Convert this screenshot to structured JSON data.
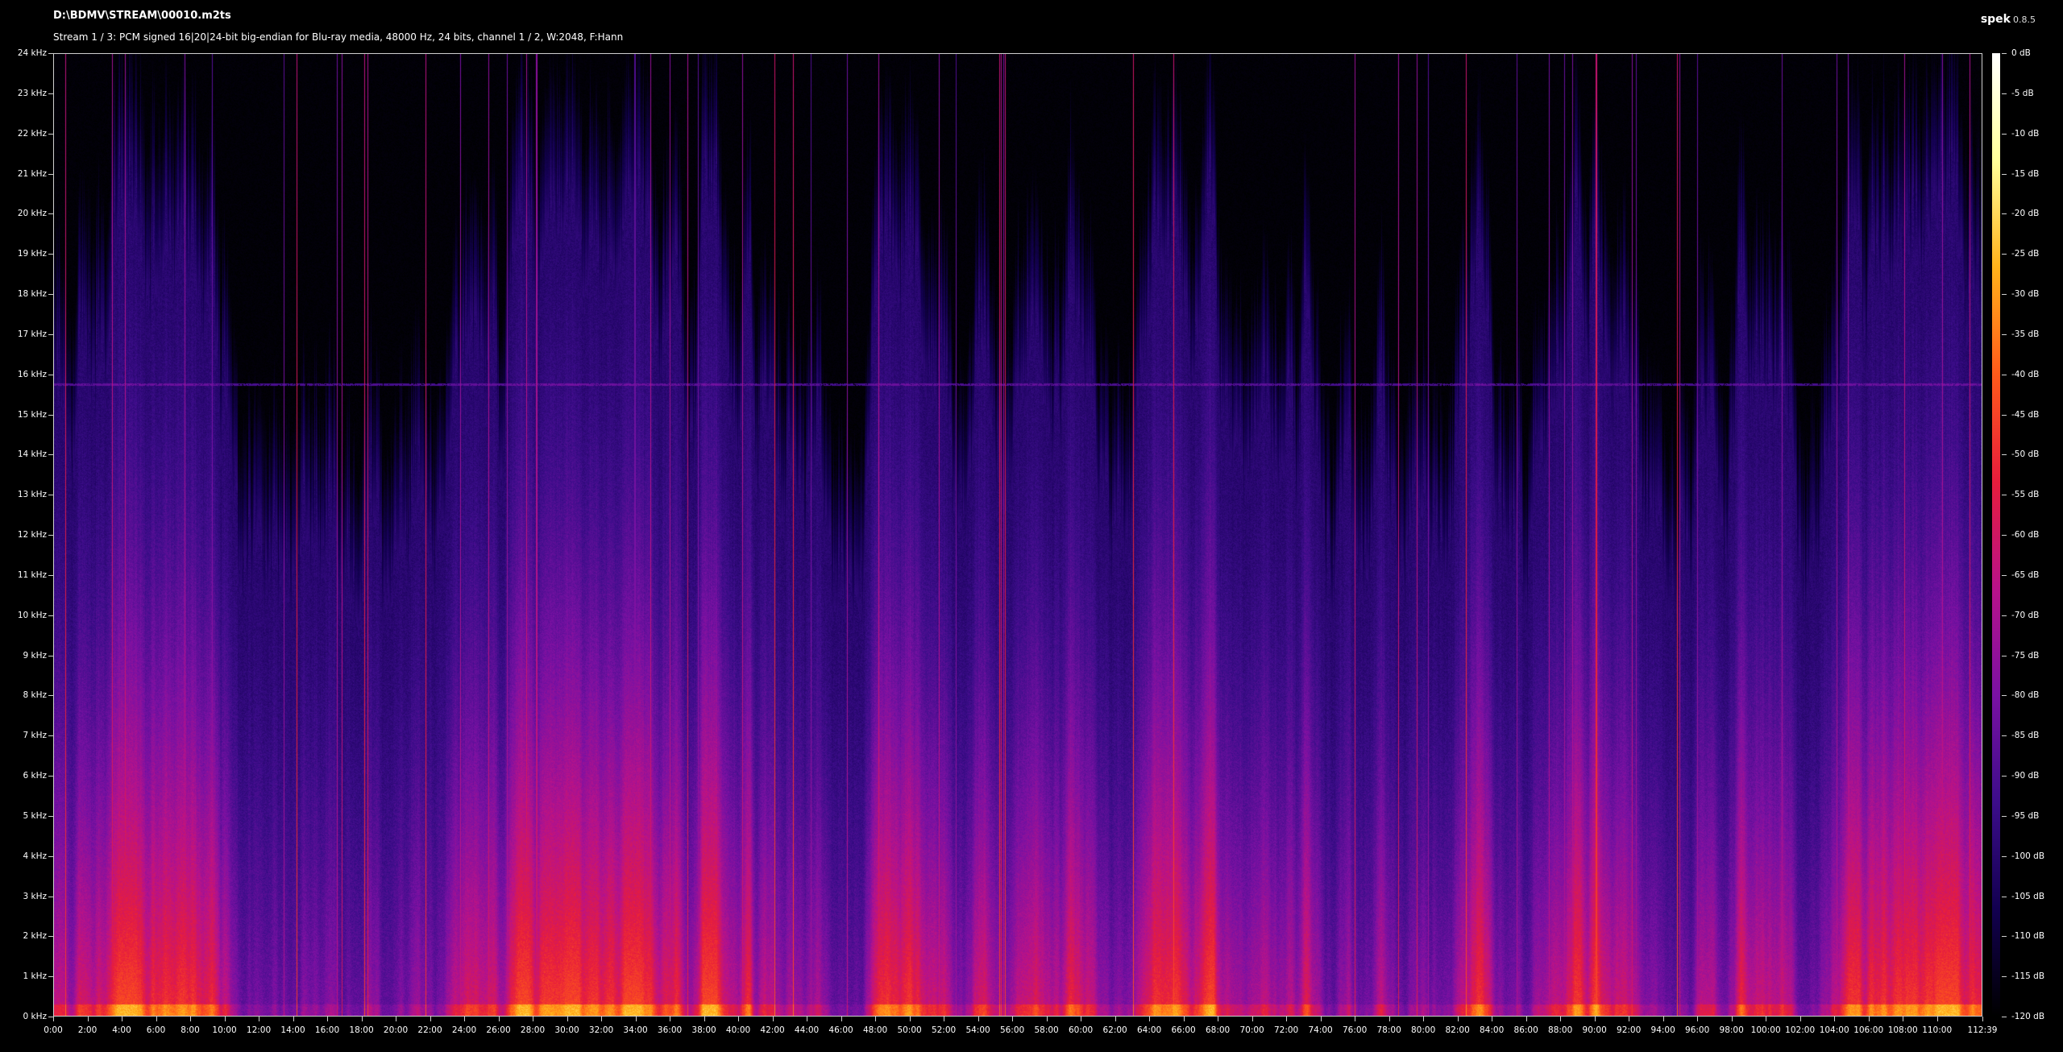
{
  "header": {
    "file_path": "D:\\BDMV\\STREAM\\00010.m2ts",
    "stream_info": "Stream 1 / 3: PCM signed 16|20|24-bit big-endian for Blu-ray media, 48000 Hz, 24 bits, channel 1 / 2, W:2048, F:Hann"
  },
  "app": {
    "name": "spek",
    "version": "0.8.5"
  },
  "colors": {
    "background": "#000000",
    "axis_line": "#cfcfcf",
    "text": "#ffffff",
    "palette": [
      "#000000",
      "#120050",
      "#3c0d8a",
      "#7a11a3",
      "#b8128a",
      "#e71d3c",
      "#ff5a1a",
      "#ffb21a",
      "#ffff9a",
      "#ffffff"
    ]
  },
  "frequency_axis": {
    "unit": "kHz",
    "range": [
      0,
      24
    ],
    "labels": [
      "0 kHz",
      "1 kHz",
      "2 kHz",
      "3 kHz",
      "4 kHz",
      "5 kHz",
      "6 kHz",
      "7 kHz",
      "8 kHz",
      "9 kHz",
      "10 kHz",
      "11 kHz",
      "12 kHz",
      "13 kHz",
      "14 kHz",
      "15 kHz",
      "16 kHz",
      "17 kHz",
      "18 kHz",
      "19 kHz",
      "20 kHz",
      "21 kHz",
      "22 kHz",
      "23 kHz",
      "24 kHz"
    ]
  },
  "time_axis": {
    "unit": "minutes",
    "range": [
      0,
      112.65
    ],
    "labels": [
      "0:00",
      "2:00",
      "4:00",
      "6:00",
      "8:00",
      "10:00",
      "12:00",
      "14:00",
      "16:00",
      "18:00",
      "20:00",
      "22:00",
      "24:00",
      "26:00",
      "28:00",
      "30:00",
      "32:00",
      "34:00",
      "36:00",
      "38:00",
      "40:00",
      "42:00",
      "44:00",
      "46:00",
      "48:00",
      "50:00",
      "52:00",
      "54:00",
      "56:00",
      "58:00",
      "60:00",
      "62:00",
      "64:00",
      "66:00",
      "68:00",
      "70:00",
      "72:00",
      "74:00",
      "76:00",
      "78:00",
      "80:00",
      "82:00",
      "84:00",
      "86:00",
      "88:00",
      "90:00",
      "92:00",
      "94:00",
      "96:00",
      "98:00",
      "100:00",
      "102:00",
      "104:00",
      "106:00",
      "108:00",
      "110:00"
    ],
    "end_label": "112:39"
  },
  "level_axis": {
    "unit": "dB",
    "range": [
      -120,
      0
    ],
    "labels": [
      "0 dB",
      "-5 dB",
      "-10 dB",
      "-15 dB",
      "-20 dB",
      "-25 dB",
      "-30 dB",
      "-35 dB",
      "-40 dB",
      "-45 dB",
      "-50 dB",
      "-55 dB",
      "-60 dB",
      "-65 dB",
      "-70 dB",
      "-75 dB",
      "-80 dB",
      "-85 dB",
      "-90 dB",
      "-95 dB",
      "-100 dB",
      "-105 dB",
      "-110 dB",
      "-115 dB",
      "-120 dB"
    ]
  }
}
